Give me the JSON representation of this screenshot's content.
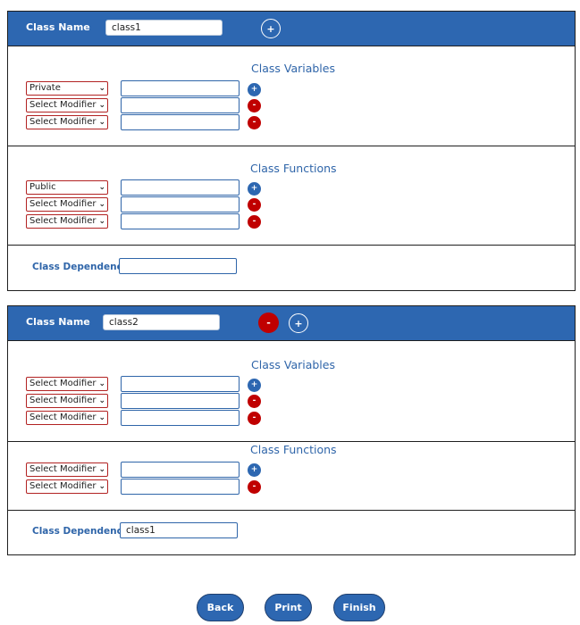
{
  "classes": [
    {
      "class_name_label": "Class Name",
      "class_name_value": "class1",
      "add_button": "+",
      "variables": {
        "title": "Class Variables",
        "rows": [
          {
            "modifier": "Private",
            "value": "",
            "action": "+"
          },
          {
            "modifier": "Select Modifier",
            "value": "",
            "action": "-"
          },
          {
            "modifier": "Select Modifier",
            "value": "",
            "action": "-"
          }
        ]
      },
      "functions": {
        "title": "Class Functions",
        "rows": [
          {
            "modifier": "Public",
            "value": "",
            "action": "+"
          },
          {
            "modifier": "Select Modifier",
            "value": "",
            "action": "-"
          },
          {
            "modifier": "Select Modifier",
            "value": "",
            "action": "-"
          }
        ]
      },
      "dependency": {
        "label": "Class Dependency",
        "value": ""
      }
    },
    {
      "class_name_label": "Class Name",
      "class_name_value": "class2",
      "remove_button": "-",
      "add_button": "+",
      "variables": {
        "title": "Class Variables",
        "rows": [
          {
            "modifier": "Select Modifier",
            "value": "",
            "action": "+"
          },
          {
            "modifier": "Select Modifier",
            "value": "",
            "action": "-"
          },
          {
            "modifier": "Select Modifier",
            "value": "",
            "action": "-"
          }
        ]
      },
      "functions": {
        "title": "Class Functions",
        "rows": [
          {
            "modifier": "Select Modifier",
            "value": "",
            "action": "+"
          },
          {
            "modifier": "Select Modifier",
            "value": "",
            "action": "-"
          }
        ]
      },
      "dependency": {
        "label": "Class Dependency",
        "value": "class1"
      }
    }
  ],
  "footer": {
    "back": "Back",
    "print": "Print",
    "finish": "Finish"
  },
  "colors": {
    "header_blue": "#2d67b1",
    "remove_red": "#c00000",
    "title_blue": "#2f65a9"
  },
  "icons": {
    "modifier_dropdown": "chevron-down-icon"
  }
}
